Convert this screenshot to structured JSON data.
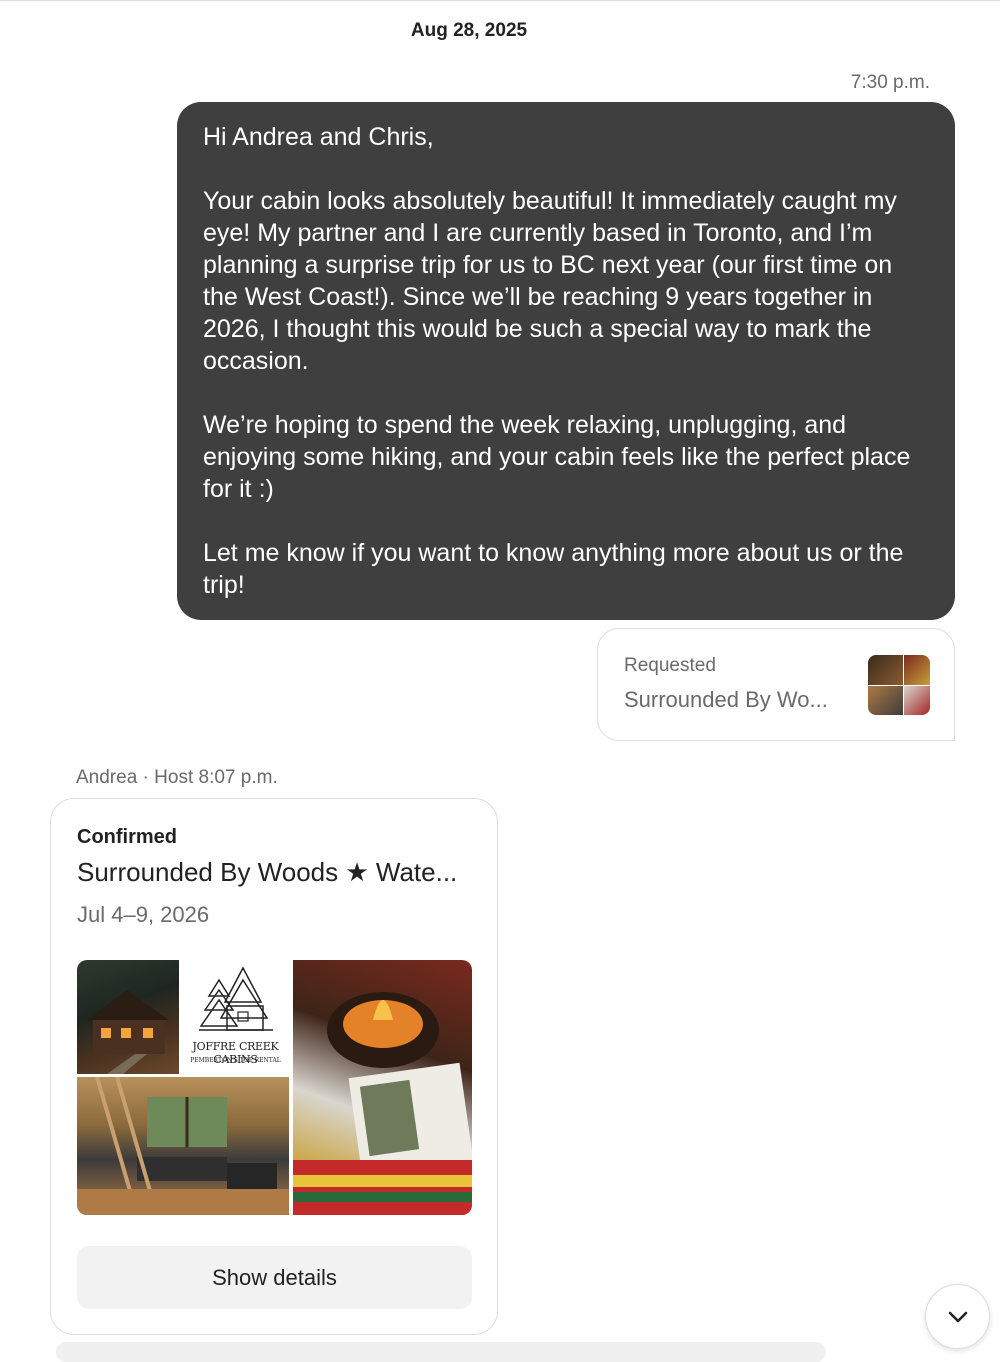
{
  "thread": {
    "date_separator": "Aug 28, 2025"
  },
  "outgoing_message": {
    "time": "7:30 p.m.",
    "text": "Hi Andrea and Chris,\n\nYour cabin looks absolutely beautiful! It immediately caught my eye! My partner and I are currently based in Toronto, and I’m planning a surprise trip for us to BC next year (our first time on the West Coast!). Since we’ll be reaching 9 years together in 2026, I thought this would be such a special way to mark the occasion.\n\nWe’re hoping to spend the week relaxing, unplugging, and enjoying some hiking, and your cabin feels like the perfect place for it :)\n\nLet me know if you want to know anything more about us or the trip!"
  },
  "request_card": {
    "status": "Requested",
    "title": "Surrounded By Wo..."
  },
  "host_message": {
    "sender": "Andrea · Host",
    "time": "8:07 p.m."
  },
  "reservation_card": {
    "status": "Confirmed",
    "title": "Surrounded By Woods ★ Wate...",
    "dates": "Jul 4–9, 2026",
    "logo_text_line1": "JOFFRE CREEK CABINS",
    "logo_text_line2": "PEMBERTON'S TOP RENTAL",
    "button_label": "Show details"
  },
  "icons": {
    "scroll_down": "chevron-down-icon"
  }
}
